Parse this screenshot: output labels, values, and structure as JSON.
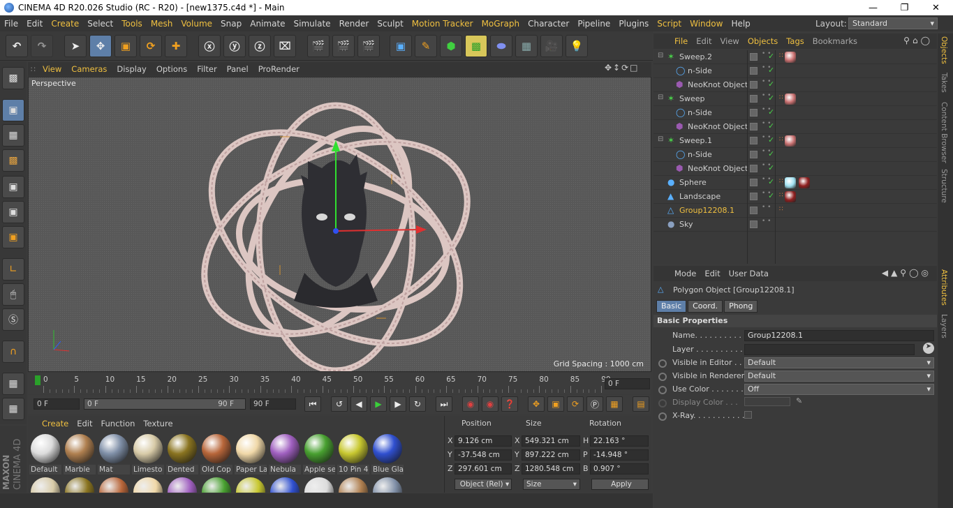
{
  "window": {
    "title": "CINEMA 4D R20.026 Studio (RC - R20) - [new1375.c4d *] - Main"
  },
  "menu": [
    "File",
    "Edit",
    "Create",
    "Select",
    "Tools",
    "Mesh",
    "Volume",
    "Snap",
    "Animate",
    "Simulate",
    "Render",
    "Sculpt",
    "Motion Tracker",
    "MoGraph",
    "Character",
    "Pipeline",
    "Plugins",
    "Script",
    "Window",
    "Help"
  ],
  "layout": {
    "label": "Layout:",
    "value": "Standard"
  },
  "viewport": {
    "menu": [
      "View",
      "Cameras",
      "Display",
      "Options",
      "Filter",
      "Panel",
      "ProRender"
    ],
    "name": "Perspective",
    "grid": "Grid Spacing : 1000 cm"
  },
  "timeline": {
    "ticks": [
      "0",
      "5",
      "10",
      "15",
      "20",
      "25",
      "30",
      "35",
      "40",
      "45",
      "50",
      "55",
      "60",
      "65",
      "70",
      "75",
      "80",
      "85",
      "90"
    ],
    "current": "0 F"
  },
  "transport": {
    "start": "0 F",
    "range_start": "0 F",
    "range_end": "90 F",
    "end": "90 F"
  },
  "materials": {
    "menu": [
      "Create",
      "Edit",
      "Function",
      "Texture"
    ],
    "items": [
      {
        "name": "Default",
        "color": "#dcdcdc"
      },
      {
        "name": "Marble",
        "color": "#b08050"
      },
      {
        "name": "Mat",
        "color": "#8090a8"
      },
      {
        "name": "Limesto",
        "color": "#d8cba8"
      },
      {
        "name": "Dented",
        "color": "#8a7420"
      },
      {
        "name": "Old Cop",
        "color": "#b8663a"
      },
      {
        "name": "Paper La",
        "color": "#f0d8a8"
      },
      {
        "name": "Nebula",
        "color": "#a060c0"
      },
      {
        "name": "Apple se",
        "color": "#48a030"
      },
      {
        "name": "10 Pin 4",
        "color": "#c8c830"
      },
      {
        "name": "Blue Gla",
        "color": "#3050d0"
      }
    ]
  },
  "coords": {
    "headers": [
      "Position",
      "Size",
      "Rotation"
    ],
    "rows": [
      {
        "axis": "X",
        "pos": "9.126 cm",
        "saxis": "X",
        "size": "549.321 cm",
        "raxis": "H",
        "rot": "22.163 °"
      },
      {
        "axis": "Y",
        "pos": "-37.548 cm",
        "saxis": "Y",
        "size": "897.222 cm",
        "raxis": "P",
        "rot": "-14.948 °"
      },
      {
        "axis": "Z",
        "pos": "297.601 cm",
        "saxis": "Z",
        "size": "1280.548 cm",
        "raxis": "B",
        "rot": "0.907 °"
      }
    ],
    "mode": "Object (Rel)",
    "size_mode": "Size",
    "apply": "Apply"
  },
  "objects": {
    "menu": [
      "File",
      "Edit",
      "View",
      "Objects",
      "Tags",
      "Bookmarks"
    ],
    "rows": [
      {
        "name": "Sweep.2",
        "indent": 0,
        "icon": "sweep"
      },
      {
        "name": "n-Side",
        "indent": 1,
        "icon": "nside"
      },
      {
        "name": "NeoKnot Object",
        "indent": 1,
        "icon": "knot"
      },
      {
        "name": "Sweep",
        "indent": 0,
        "icon": "sweep"
      },
      {
        "name": "n-Side",
        "indent": 1,
        "icon": "nside"
      },
      {
        "name": "NeoKnot Object",
        "indent": 1,
        "icon": "knot"
      },
      {
        "name": "Sweep.1",
        "indent": 0,
        "icon": "sweep"
      },
      {
        "name": "n-Side",
        "indent": 1,
        "icon": "nside"
      },
      {
        "name": "NeoKnot Object",
        "indent": 1,
        "icon": "knot"
      },
      {
        "name": "Sphere",
        "indent": 0,
        "icon": "sphere"
      },
      {
        "name": "Landscape",
        "indent": 0,
        "icon": "landscape"
      },
      {
        "name": "Group12208.1",
        "indent": 0,
        "icon": "polygon",
        "selected": true
      },
      {
        "name": "Sky",
        "indent": 0,
        "icon": "sky"
      }
    ]
  },
  "sidetabs": [
    "Objects",
    "Takes",
    "Content Browser",
    "Structure",
    "Attributes",
    "Layers"
  ],
  "attributes": {
    "menu": [
      "Mode",
      "Edit",
      "User Data"
    ],
    "object": "Polygon Object [Group12208.1]",
    "tabs": [
      "Basic",
      "Coord.",
      "Phong"
    ],
    "section": "Basic Properties",
    "name_label": "Name. . . . . . . . . . . . .",
    "name_value": "Group12208.1",
    "layer_label": "Layer . . . . . . . . . . . .",
    "vis_editor_label": "Visible in Editor . . .",
    "vis_editor": "Default",
    "vis_render_label": "Visible in Renderer",
    "vis_render": "Default",
    "use_color_label": "Use Color . . . . . . . .",
    "use_color": "Off",
    "display_color_label": "Display Color . . .",
    "xray_label": "X-Ray. . . . . . . . . . . ."
  },
  "brand": {
    "maxon": "MAXON",
    "c4d": "CINEMA 4D"
  }
}
